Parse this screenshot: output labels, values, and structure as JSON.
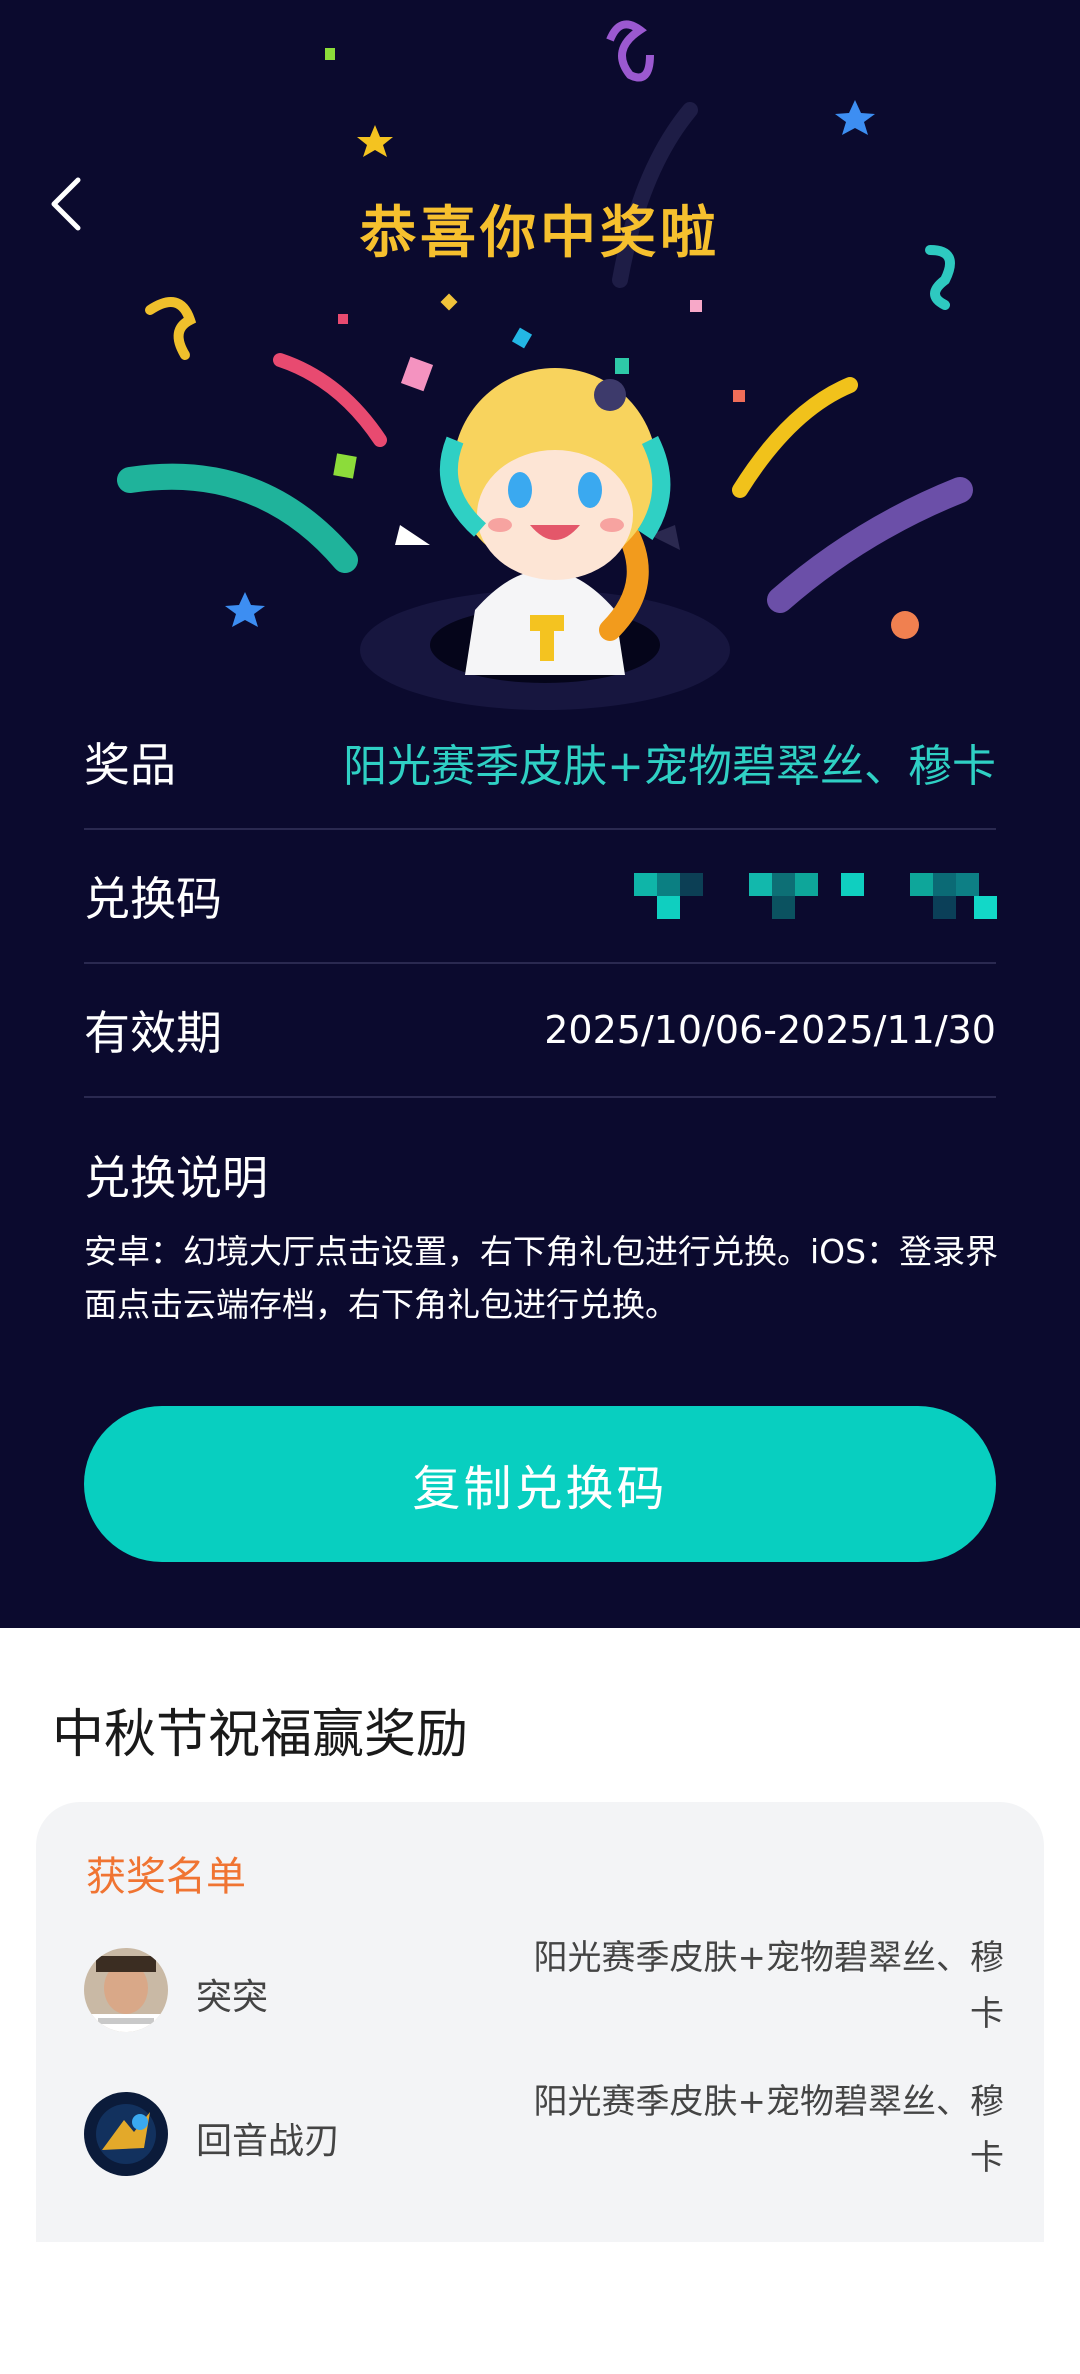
{
  "header": {
    "title": "恭喜你中奖啦"
  },
  "prize": {
    "label": "奖品",
    "value": "阳光赛季皮肤+宠物碧翠丝、穆卡"
  },
  "code": {
    "label": "兑换码"
  },
  "validity": {
    "label": "有效期",
    "value": "2025/10/06-2025/11/30"
  },
  "instructions": {
    "title": "兑换说明",
    "text": "安卓：幻境大厅点击设置，右下角礼包进行兑换。iOS：登录界面点击云端存档，右下角礼包进行兑换。"
  },
  "copy_button": {
    "label": "复制兑换码"
  },
  "section": {
    "title": "中秋节祝福赢奖励"
  },
  "winners": {
    "title": "获奖名单",
    "items": [
      {
        "name": "突突",
        "prize": "阳光赛季皮肤+宠物碧翠丝、穆卡"
      },
      {
        "name": "回音战刃",
        "prize": "阳光赛季皮肤+宠物碧翠丝、穆卡"
      }
    ]
  },
  "colors": {
    "top_background": "#0b0a2e",
    "accent_teal": "#08cfc0",
    "title_gold": "#f6c02e",
    "winners_title": "#f07432"
  },
  "icons": {
    "back": "chevron-left-icon",
    "mascot": "mascot-illustration"
  }
}
